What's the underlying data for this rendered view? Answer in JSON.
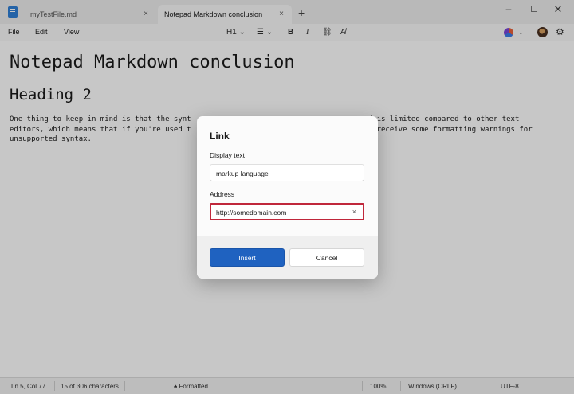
{
  "tabs": [
    {
      "label": "myTestFile.md",
      "active": false
    },
    {
      "label": "Notepad Markdown conclusion",
      "active": true
    }
  ],
  "tab_close_glyph": "×",
  "tab_add_glyph": "+",
  "menu": {
    "file": "File",
    "edit": "Edit",
    "view": "View"
  },
  "toolbar": {
    "heading": "H1 ⌄",
    "list": "☰ ⌄",
    "bold": "B",
    "italic": "I",
    "link": "⛓",
    "clear": "A̸",
    "chevron": "⌄",
    "gear": "⚙"
  },
  "document": {
    "heading1": "Notepad Markdown conclusion",
    "heading2": "Heading 2",
    "paragraph": "One thing to keep in mind is that the synt                                      epad is limited compared to other text\neditors, which means that if you're used t                                      will receive some formatting warnings for\nunsupported syntax."
  },
  "statusbar": {
    "position": "Ln 5, Col 77",
    "count": "15 of 306 characters",
    "format": "Formatted",
    "zoom": "100%",
    "line_ending": "Windows (CRLF)",
    "encoding": "UTF-8"
  },
  "dialog": {
    "title": "Link",
    "display_label": "Display text",
    "display_value": "markup language",
    "address_label": "Address",
    "address_value": "http://somedomain.com",
    "clear_glyph": "×",
    "insert_label": "Insert",
    "cancel_label": "Cancel"
  },
  "colors": {
    "accent": "#1f62c0",
    "highlight": "#c0273b"
  }
}
